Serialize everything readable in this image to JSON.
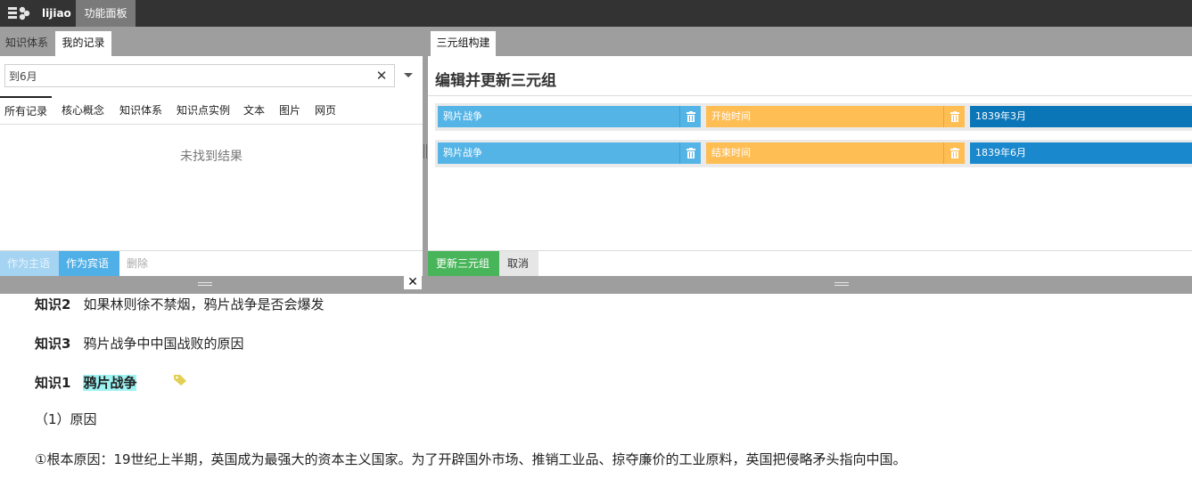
{
  "topbar": {
    "logo_icon": "app-logo-icon",
    "username": "lijiao",
    "active_tab": "功能面板"
  },
  "left_panel": {
    "tabs": [
      "知识体系",
      "我的记录"
    ],
    "search": {
      "value": "到6月",
      "placeholder": ""
    },
    "filters": [
      "所有记录",
      "核心概念",
      "知识体系",
      "知识点实例",
      "文本",
      "图片",
      "网页"
    ],
    "empty_message": "未找到结果",
    "actions": {
      "as_subject": "作为主语",
      "as_object": "作为宾语",
      "delete": "删除"
    }
  },
  "right_panel": {
    "tab": "三元组构建",
    "title": "编辑并更新三元组",
    "triples": [
      {
        "subject": "鸦片战争",
        "predicate": "开始时间",
        "object": "1839年3月"
      },
      {
        "subject": "鸦片战争",
        "predicate": "结束时间",
        "object": "1839年6月"
      }
    ],
    "actions": {
      "update": "更新三元组",
      "cancel": "取消"
    }
  },
  "document": {
    "lines": [
      {
        "num": "知识2",
        "text": "如果林则徐不禁烟，鸦片战争是否会爆发"
      },
      {
        "num": "知识3",
        "text": "鸦片战争中中国战败的原因"
      },
      {
        "num": "知识1",
        "text": "鸦片战争"
      }
    ],
    "sub_heading": "（1）原因",
    "paragraph": "①根本原因：19世纪上半期，英国成为最强大的资本主义国家。为了开辟国外市场、推销工业品、掠夺廉价的工业原料，英国把侵略矛头指向中国。"
  },
  "colors": {
    "subject": "#55b4e6",
    "predicate": "#ffbe54",
    "object": "#0a76b8",
    "update_button": "#49b55a",
    "highlight": "#9ef3f3"
  }
}
